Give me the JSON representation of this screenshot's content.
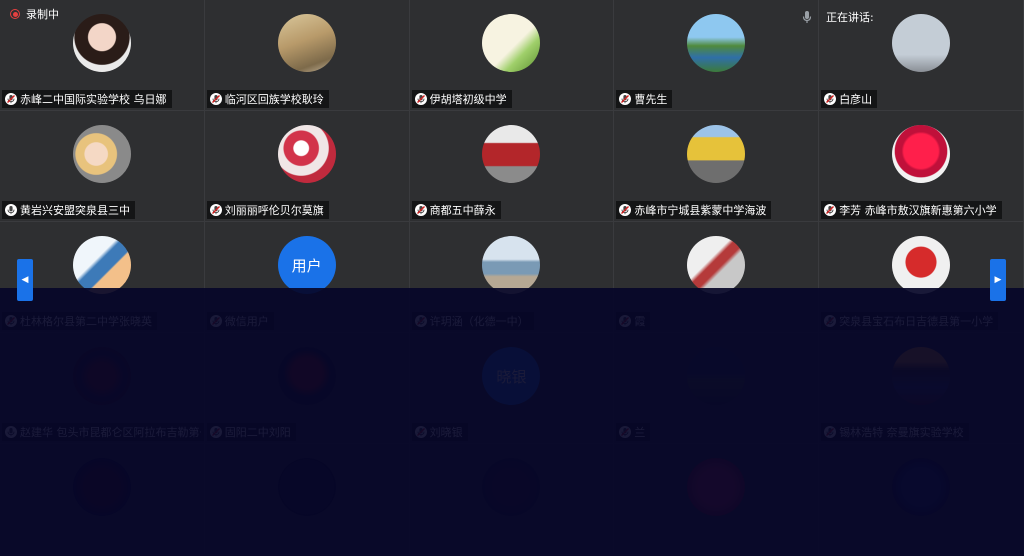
{
  "recording": {
    "label": "录制中"
  },
  "speaking": {
    "label": "正在讲话:",
    "icon": "microphone-icon"
  },
  "pager": {
    "prev_icon": "chevron-left-icon",
    "next_icon": "chevron-right-icon"
  },
  "participants": [
    {
      "name": "赤峰二中国际实验学校 乌日娜",
      "avatar": "anime-girl-photo",
      "muted": true
    },
    {
      "name": "临河区回族学校耿玲",
      "avatar": "reeds-photo",
      "muted": true
    },
    {
      "name": "伊胡塔初级中学",
      "avatar": "calligraphy-photo",
      "muted": true
    },
    {
      "name": "曹先生",
      "avatar": "lake-landscape-photo",
      "muted": true
    },
    {
      "name": "白彦山",
      "avatar": "sky-photo",
      "muted": true
    },
    {
      "name": "黄岩兴安盟突泉县三中",
      "avatar": "baby-cat-photo",
      "muted": false
    },
    {
      "name": "刘丽丽呼伦贝尔莫旗",
      "avatar": "flowers-photo",
      "muted": true
    },
    {
      "name": "商都五中薛永",
      "avatar": "red-bridge-photo",
      "muted": true
    },
    {
      "name": "赤峰市宁城县紫蒙中学海波",
      "avatar": "autumn-road-photo",
      "muted": true
    },
    {
      "name": "李芳 赤峰市敖汉旗新惠第六小学",
      "avatar": "red-rose-photo",
      "muted": true
    },
    {
      "name": "杜林格尔县第二中学张晓英",
      "avatar": "cartoon-photo",
      "muted": true
    },
    {
      "name": "微信用户",
      "avatar_text": "用户",
      "muted": true
    },
    {
      "name": "许玥涵（化德一中）",
      "avatar": "seaside-photo",
      "muted": true
    },
    {
      "name": "霞",
      "avatar": "room-photo",
      "muted": true
    },
    {
      "name": "突泉县宝石布日吉德县第一小学",
      "avatar": "girl-costume-photo",
      "muted": true
    },
    {
      "name": "赵建华 包头市昆都仑区阿拉布吉勒第一完全小",
      "avatar": "red-dark-photo",
      "muted": false
    },
    {
      "name": "固阳二中刘阳",
      "avatar": "red-flower-photo",
      "muted": true
    },
    {
      "name": "刘晓银",
      "avatar_text": "晓银",
      "muted": true
    },
    {
      "name": "兰",
      "avatar": "mountain-photo",
      "muted": true
    },
    {
      "name": "锡林浩特 奈曼旗实验学校",
      "avatar": "sunset-photo",
      "muted": true
    },
    {
      "name": "",
      "avatar": "dark-red-photo",
      "muted": false
    },
    {
      "name": "",
      "avatar": "dark-photo",
      "muted": false
    },
    {
      "name": "",
      "avatar": "portrait-photo",
      "muted": false
    },
    {
      "name": "",
      "avatar": "pink-photo",
      "muted": false
    },
    {
      "name": "",
      "avatar": "blue-photo",
      "muted": false
    }
  ],
  "colors": {
    "accent": "#1a72e8",
    "record": "#e64040",
    "tile_bg": "#2e2f31"
  }
}
